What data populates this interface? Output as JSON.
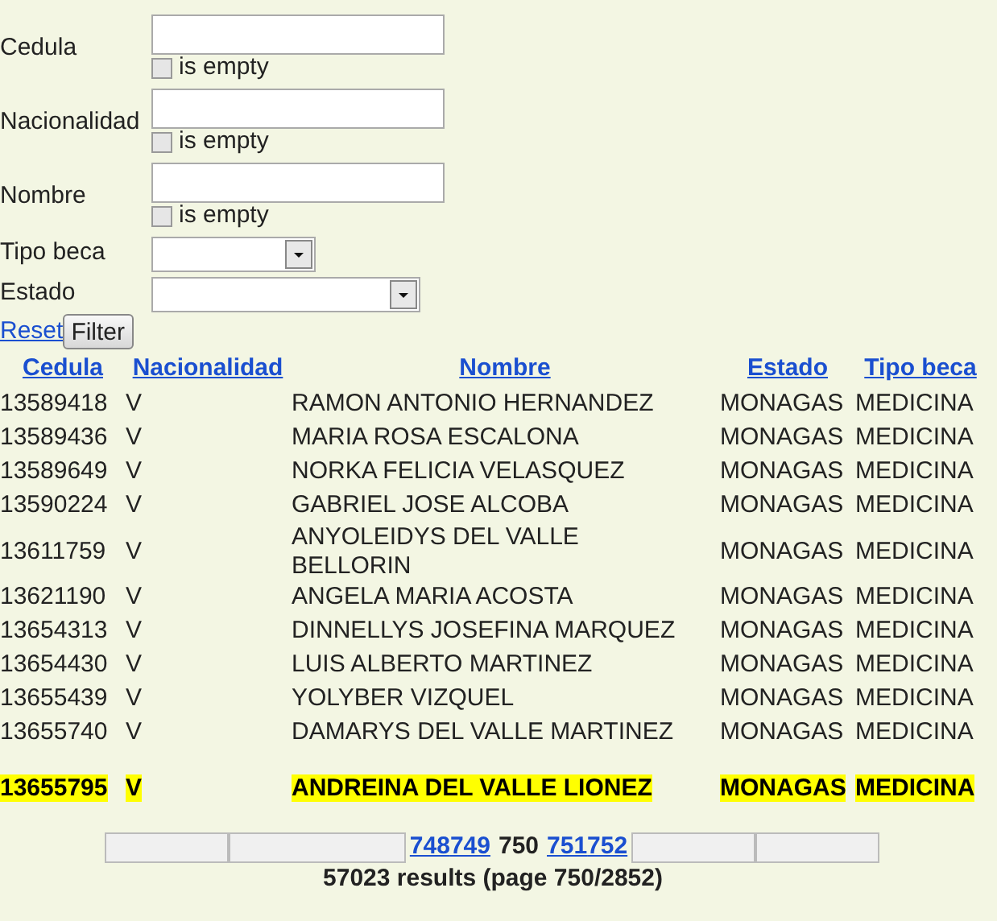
{
  "filters": [
    {
      "kind": "text",
      "label": "Cedula",
      "empty_label": "is empty",
      "empty_checked": false
    },
    {
      "kind": "text",
      "label": "Nacionalidad",
      "empty_label": "is empty",
      "empty_checked": false
    },
    {
      "kind": "text",
      "label": "Nombre",
      "empty_label": "is empty",
      "empty_checked": false
    },
    {
      "kind": "select",
      "label": "Tipo beca"
    },
    {
      "kind": "select",
      "label": "Estado"
    }
  ],
  "reset_link": "Reset",
  "filter_button": "Filter",
  "table": {
    "columns": [
      "Cedula",
      "Nacionalidad",
      "Nombre",
      "Estado",
      "Tipo beca"
    ],
    "rows": [
      {
        "cells": [
          "13589418",
          "V",
          "RAMON ANTONIO HERNANDEZ",
          "MONAGAS",
          "MEDICINA"
        ],
        "selected": false
      },
      {
        "cells": [
          "13589436",
          "V",
          "MARIA ROSA ESCALONA",
          "MONAGAS",
          "MEDICINA"
        ],
        "selected": false
      },
      {
        "cells": [
          "13589649",
          "V",
          "NORKA FELICIA VELASQUEZ",
          "MONAGAS",
          "MEDICINA"
        ],
        "selected": false
      },
      {
        "cells": [
          "13590224",
          "V",
          "GABRIEL JOSE ALCOBA",
          "MONAGAS",
          "MEDICINA"
        ],
        "selected": false
      },
      {
        "cells": [
          "13611759",
          "V",
          "ANYOLEIDYS DEL VALLE BELLORIN",
          "MONAGAS",
          "MEDICINA"
        ],
        "selected": false
      },
      {
        "cells": [
          "13621190",
          "V",
          "ANGELA MARIA ACOSTA",
          "MONAGAS",
          "MEDICINA"
        ],
        "selected": false
      },
      {
        "cells": [
          "13654313",
          "V",
          "DINNELLYS JOSEFINA MARQUEZ",
          "MONAGAS",
          "MEDICINA"
        ],
        "selected": false
      },
      {
        "cells": [
          "13654430",
          "V",
          "LUIS ALBERTO MARTINEZ",
          "MONAGAS",
          "MEDICINA"
        ],
        "selected": false
      },
      {
        "cells": [
          "13655439",
          "V",
          "YOLYBER VIZQUEL",
          "MONAGAS",
          "MEDICINA"
        ],
        "selected": false
      },
      {
        "cells": [
          "13655740",
          "V",
          "DAMARYS DEL VALLE MARTINEZ",
          "MONAGAS",
          "MEDICINA"
        ],
        "selected": false
      },
      {
        "cells": [
          "13655795",
          "V",
          "ANDREINA DEL VALLE LIONEZ",
          "MONAGAS",
          "MEDICINA"
        ],
        "selected": true
      }
    ]
  },
  "pager": {
    "pages": [
      {
        "label": "748",
        "selected": false
      },
      {
        "label": "749",
        "selected": false
      },
      {
        "label": "750",
        "selected": true
      },
      {
        "label": "751",
        "selected": false
      },
      {
        "label": "752",
        "selected": false
      }
    ],
    "summary": "57023 results (page 750/2852)"
  }
}
